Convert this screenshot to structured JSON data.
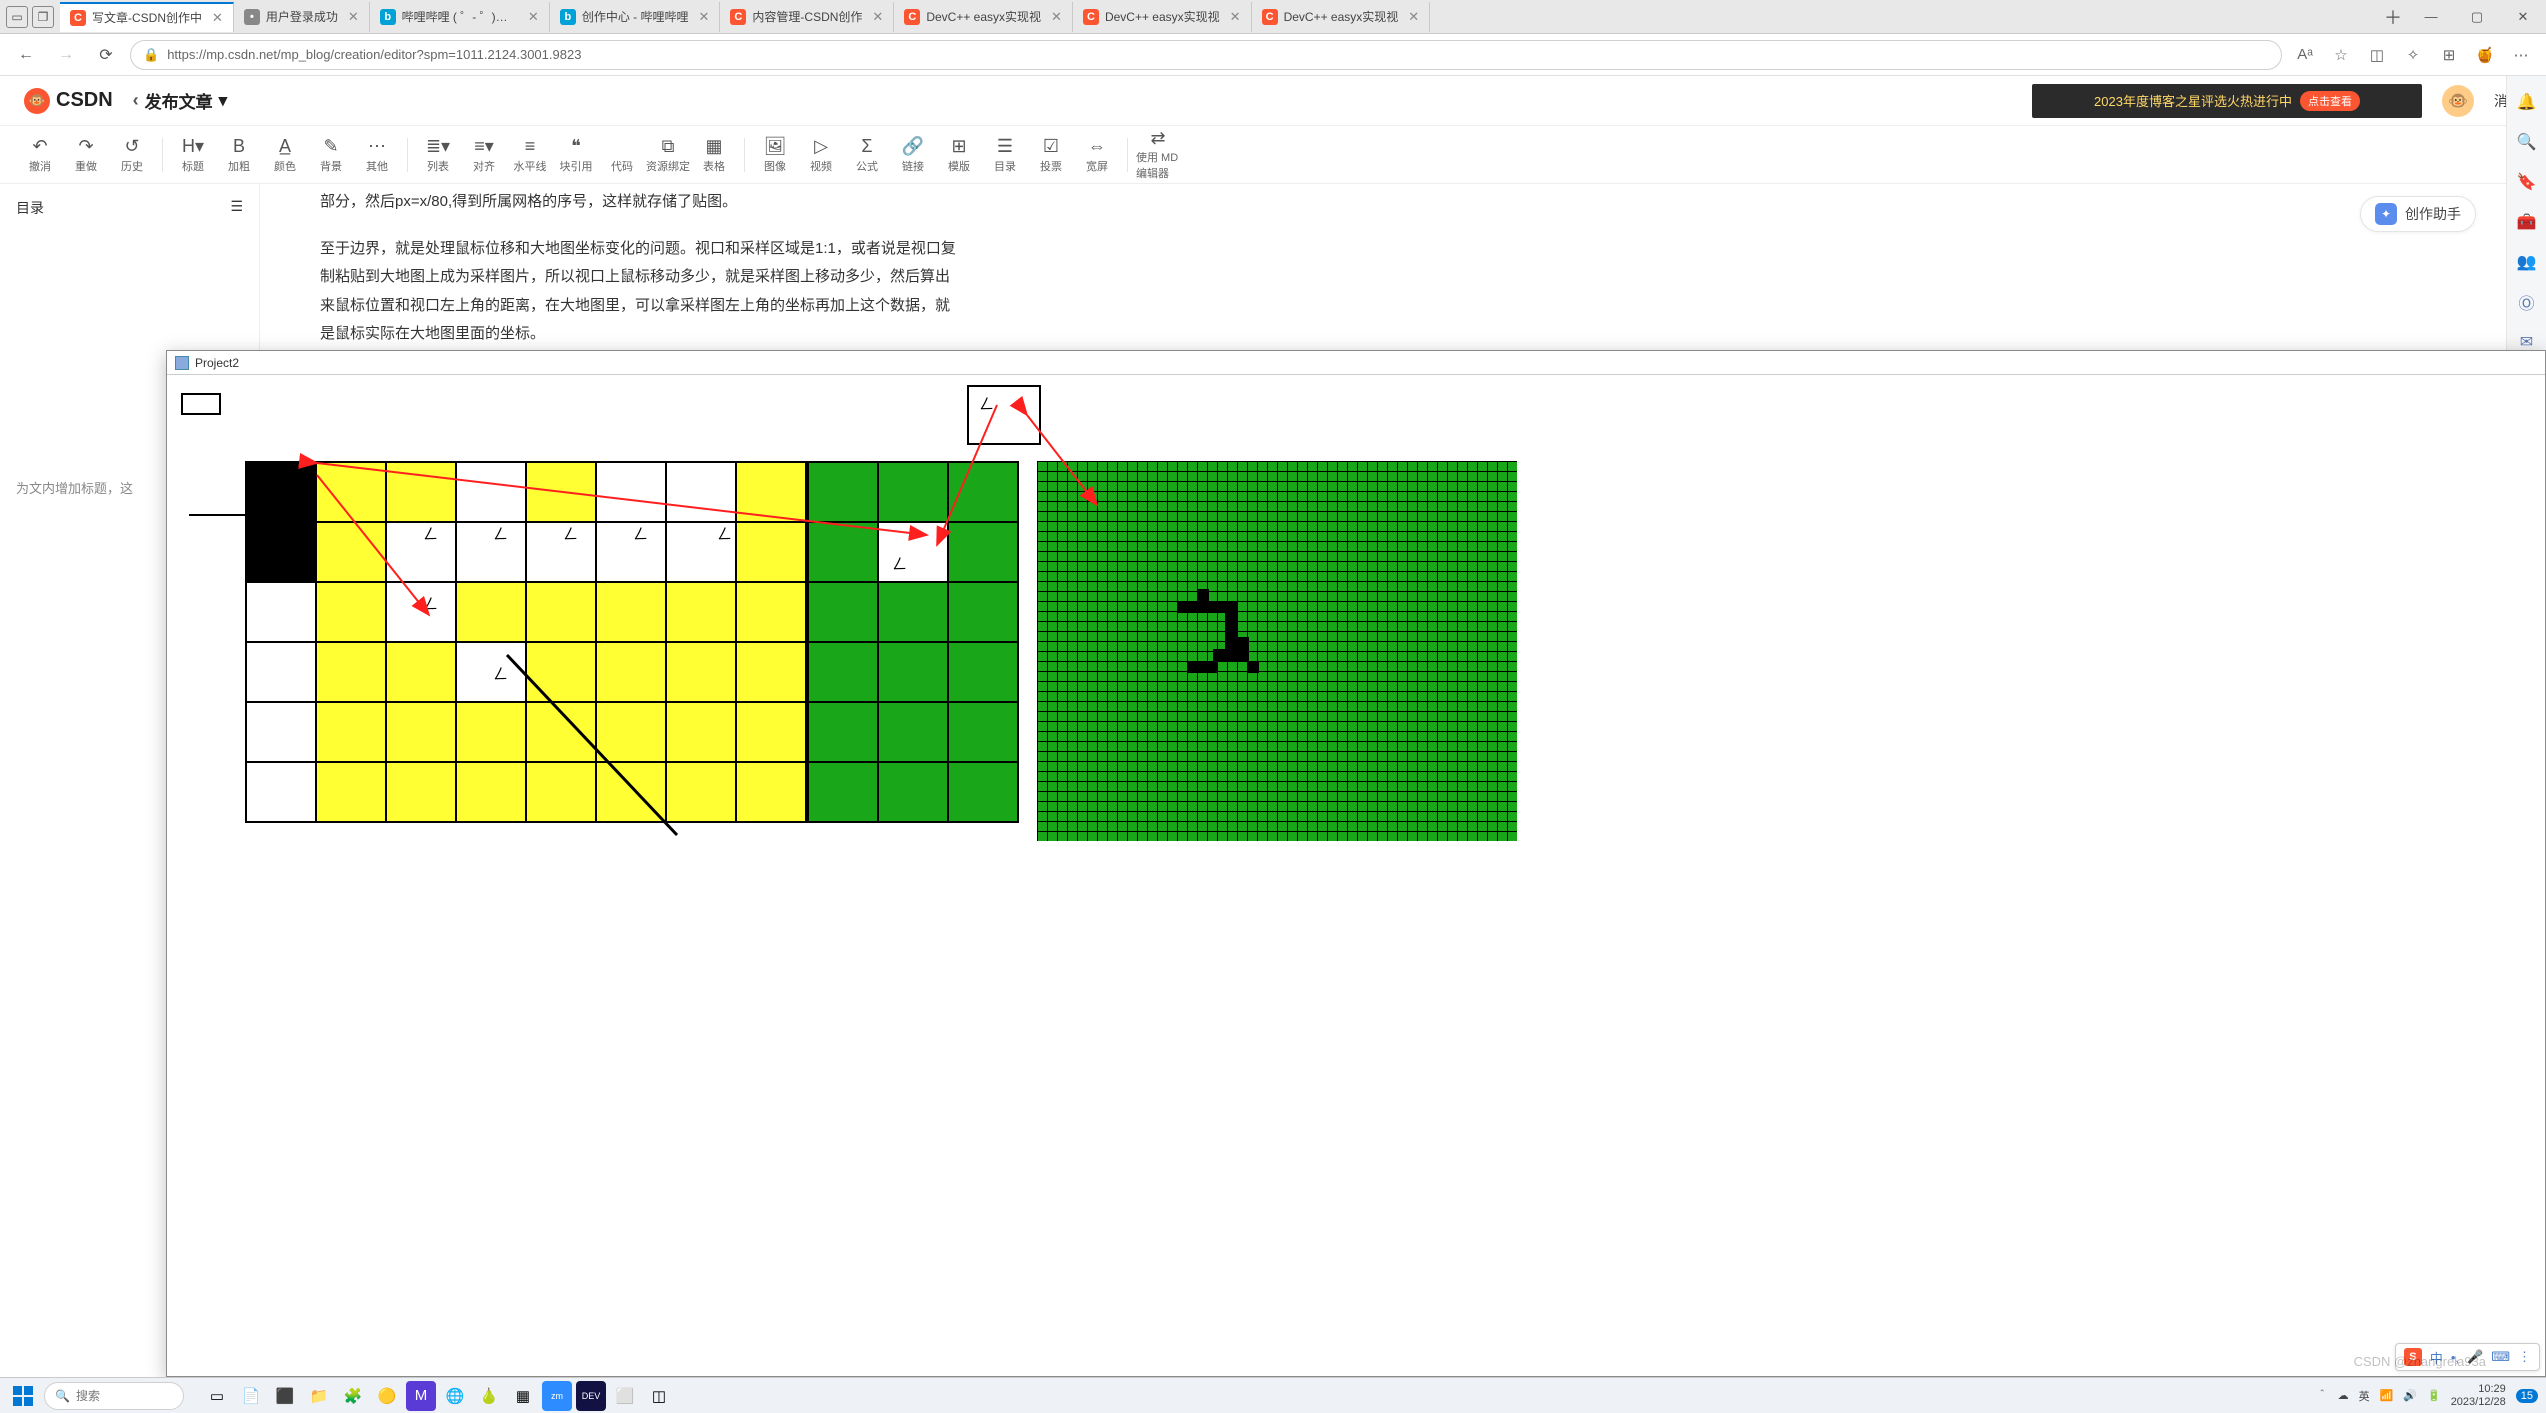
{
  "browser": {
    "tabs": [
      {
        "label": "写文章-CSDN创作中",
        "fav": "C",
        "favCls": "fav-c",
        "active": true
      },
      {
        "label": "用户登录成功",
        "fav": "•",
        "favCls": "fav-g"
      },
      {
        "label": "哔哩哔哩 ( ゜- ゜)つロ",
        "fav": "b",
        "favCls": "fav-b"
      },
      {
        "label": "创作中心 - 哔哩哔哩",
        "fav": "b",
        "favCls": "fav-b"
      },
      {
        "label": "内容管理-CSDN创作",
        "fav": "C",
        "favCls": "fav-c"
      },
      {
        "label": "DevC++ easyx实现视",
        "fav": "C",
        "favCls": "fav-c"
      },
      {
        "label": "DevC++ easyx实现视",
        "fav": "C",
        "favCls": "fav-c"
      },
      {
        "label": "DevC++ easyx实现视",
        "fav": "C",
        "favCls": "fav-c"
      }
    ],
    "url": "https://mp.csdn.net/mp_blog/creation/editor?spm=1011.2124.3001.9823",
    "win_min": "—",
    "win_max": "▢",
    "win_close": "✕"
  },
  "csdn": {
    "logo": "CSDN",
    "publish_back": "‹",
    "publish_label": "发布文章",
    "publish_caret": "▾",
    "promo_text": "2023年度博客之星评选火热进行中",
    "promo_btn": "点击查看",
    "messages": "消息"
  },
  "toolbar": {
    "items": [
      {
        "glyph": "↶",
        "label": "撤消"
      },
      {
        "glyph": "↷",
        "label": "重做"
      },
      {
        "glyph": "↺",
        "label": "历史"
      },
      {
        "sep": true
      },
      {
        "glyph": "H▾",
        "label": "标题"
      },
      {
        "glyph": "B",
        "label": "加粗"
      },
      {
        "glyph": "A̲",
        "label": "颜色"
      },
      {
        "glyph": "✎",
        "label": "背景"
      },
      {
        "glyph": "⋯",
        "label": "其他"
      },
      {
        "sep": true
      },
      {
        "glyph": "≣▾",
        "label": "列表"
      },
      {
        "glyph": "≡▾",
        "label": "对齐"
      },
      {
        "glyph": "≡",
        "label": "水平线"
      },
      {
        "glyph": "❝",
        "label": "块引用"
      },
      {
        "glyph": "</>",
        "label": "代码"
      },
      {
        "glyph": "⧉",
        "label": "资源绑定"
      },
      {
        "glyph": "▦",
        "label": "表格"
      },
      {
        "sep": true
      },
      {
        "glyph": "🖼",
        "label": "图像"
      },
      {
        "glyph": "▷",
        "label": "视频"
      },
      {
        "glyph": "Σ",
        "label": "公式"
      },
      {
        "glyph": "🔗",
        "label": "链接"
      },
      {
        "glyph": "⊞",
        "label": "模版"
      },
      {
        "glyph": "☰",
        "label": "目录"
      },
      {
        "glyph": "☑",
        "label": "投票"
      },
      {
        "glyph": "⇔",
        "label": "宽屏"
      },
      {
        "sep": true
      },
      {
        "glyph": "⇄",
        "label": "使用 MD 编辑器"
      }
    ]
  },
  "toc": {
    "title": "目录",
    "toggle": "☰",
    "hint": "为文内增加标题，这"
  },
  "content": {
    "p1": "部分，然后px=x/80,得到所属网格的序号，这样就存储了贴图。",
    "p2": "至于边界，就是处理鼠标位移和大地图坐标变化的问题。视口和采样区域是1:1，或者说是视口复制粘贴到大地图上成为采样图片，所以视口上鼠标移动多少，就是采样图上移动多少，然后算出来鼠标位置和视口左上角的距离，在大地图里，可以拿采样图左上角的坐标再加上这个数据，就是鼠标实际在大地图里面的坐标。"
  },
  "assistant": {
    "icon": "✦",
    "label": "创作助手"
  },
  "float": {
    "title": "Project2",
    "cursor_char": "ㄥ"
  },
  "ime": {
    "s": "S",
    "zh": "中",
    "punct": "•,",
    "mic": "🎤",
    "kbd": "⌨",
    "more": "⋮"
  },
  "taskbar": {
    "search_placeholder": "搜索",
    "watermark": "CSDN @zhangrela93a",
    "clock_time": "10:29",
    "clock_date": "2023/12/28",
    "tray_badge": "15"
  }
}
